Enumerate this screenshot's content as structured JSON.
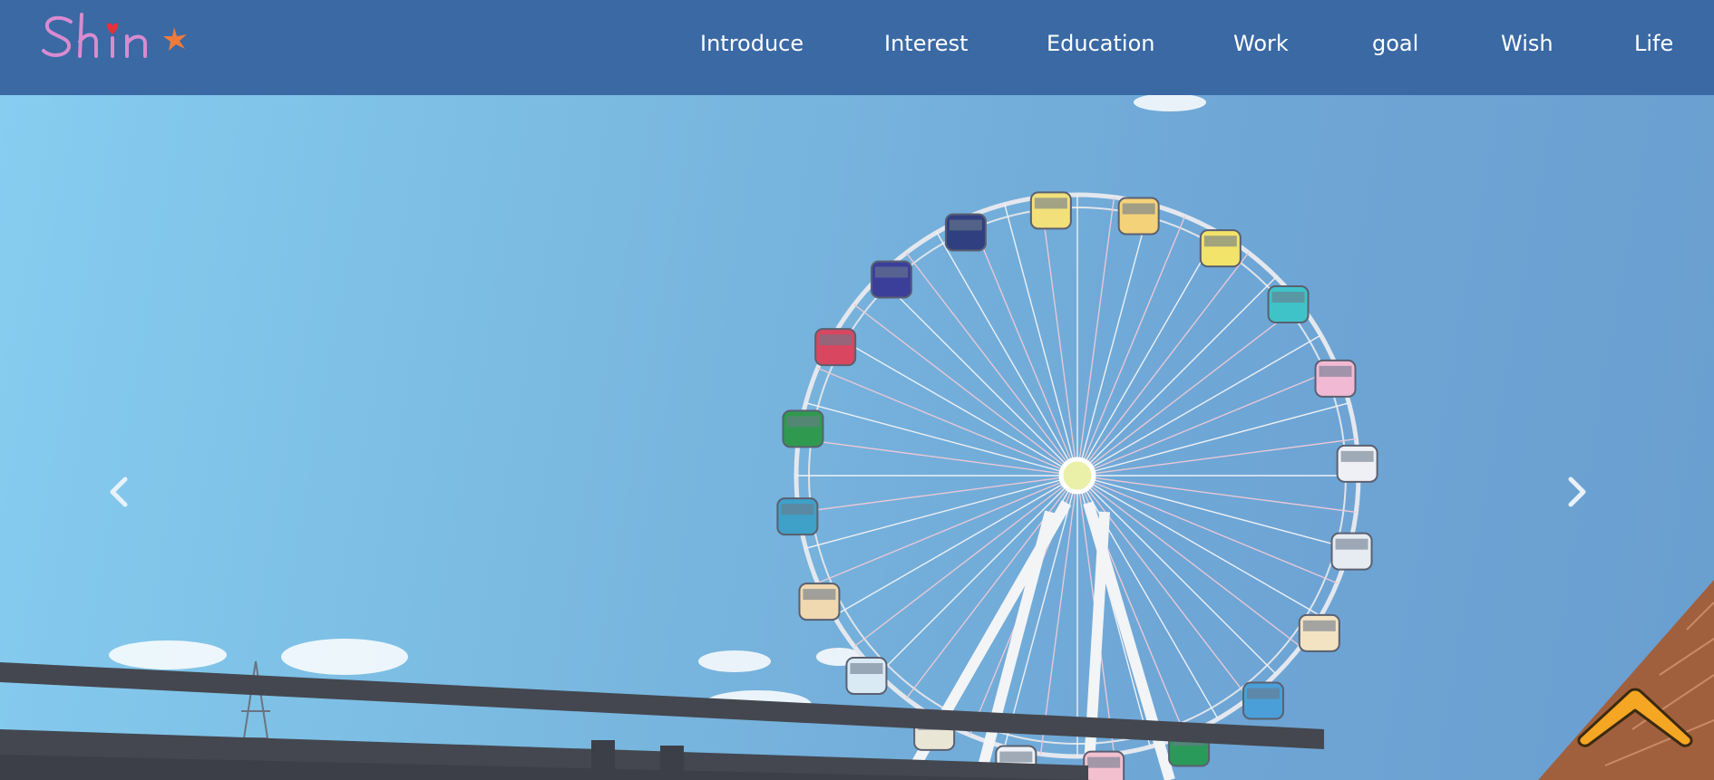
{
  "logo": {
    "text": "Shin"
  },
  "nav": {
    "items": [
      {
        "label": "Introduce"
      },
      {
        "label": "Interest"
      },
      {
        "label": "Education"
      },
      {
        "label": "Work"
      },
      {
        "label": "goal"
      },
      {
        "label": "Wish"
      },
      {
        "label": "Life"
      }
    ]
  },
  "carousel": {
    "prev_icon": "chevron-left-icon",
    "next_icon": "chevron-right-icon",
    "image_subject": "ferris-wheel-photo"
  },
  "back_to_top": {
    "icon": "chevron-up-icon",
    "color": "#f5a623"
  },
  "colors": {
    "navbar": "#3a69a4",
    "nav_text": "#ffffff",
    "sky": "#7ab9e0"
  }
}
